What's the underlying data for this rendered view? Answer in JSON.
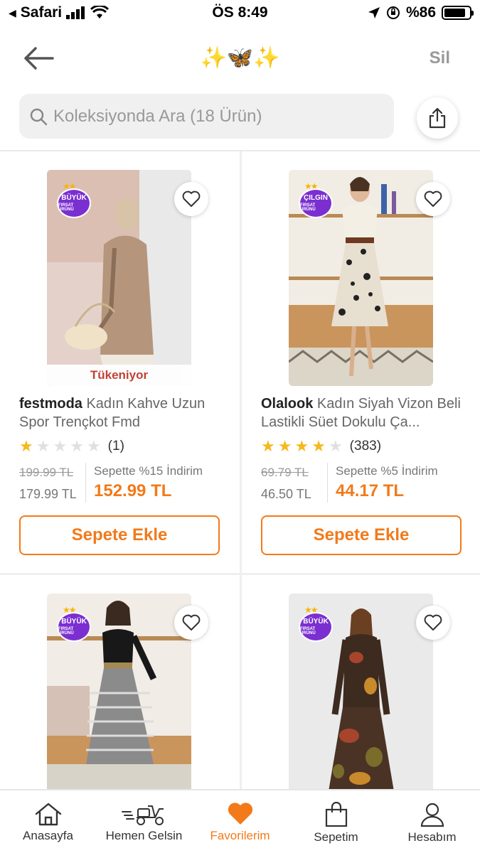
{
  "status_bar": {
    "back_app": "Safari",
    "time": "ÖS 8:49",
    "battery": "%86",
    "battery_level": 0.86
  },
  "nav": {
    "title": "✨🦋✨",
    "action": "Sil"
  },
  "search": {
    "placeholder": "Koleksiyonda Ara (18 Ürün)"
  },
  "products": [
    {
      "brand": "festmoda",
      "name": "Kadın Kahve Uzun Spor Trençkot Fmd",
      "badge_line1": "BÜYÜK",
      "badge_line2": "FIRSAT ÜRÜNÜ",
      "stock_label": "Tükeniyor",
      "rating": 1,
      "review_count": "(1)",
      "old_price": "199.99 TL",
      "mid_price": "179.99 TL",
      "discount_text": "Sepette %15 İndirim",
      "final_price": "152.99 TL",
      "button": "Sepete Ekle"
    },
    {
      "brand": "Olalook",
      "name": "Kadın Siyah Vizon Beli Lastikli Süet Dokulu Ça...",
      "badge_line1": "ÇILGIN",
      "badge_line2": "FIRSAT ÜRÜNÜ",
      "rating": 4,
      "review_count": "(383)",
      "old_price": "69.79 TL",
      "mid_price": "46.50 TL",
      "discount_text": "Sepette %5 İndirim",
      "final_price": "44.17 TL",
      "button": "Sepete Ekle"
    },
    {
      "badge_line1": "BÜYÜK",
      "badge_line2": "FIRSAT ÜRÜNÜ"
    },
    {
      "badge_line1": "BÜYÜK",
      "badge_line2": "FIRSAT ÜRÜNÜ"
    }
  ],
  "tabs": [
    {
      "label": "Anasayfa",
      "icon": "home-icon"
    },
    {
      "label": "Hemen Gelsin",
      "icon": "scooter-icon"
    },
    {
      "label": "Favorilerim",
      "icon": "heart-icon",
      "active": true
    },
    {
      "label": "Sepetim",
      "icon": "bag-icon"
    },
    {
      "label": "Hesabım",
      "icon": "user-icon"
    }
  ],
  "colors": {
    "accent": "#f27a1a",
    "badge_purple": "#7b2fd0",
    "star": "#f5b91c",
    "stock_red": "#c0392b"
  }
}
